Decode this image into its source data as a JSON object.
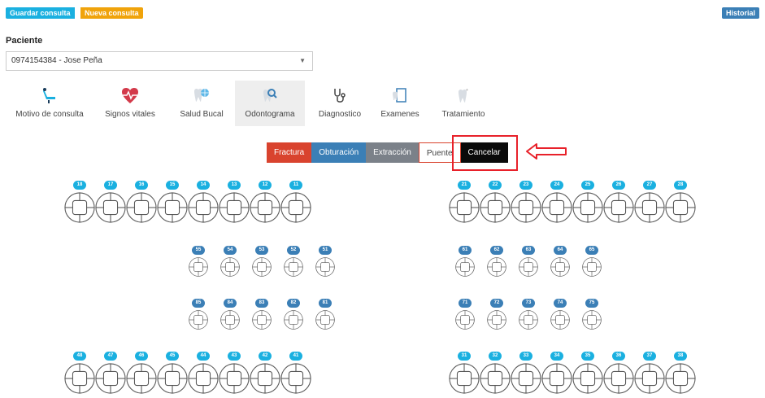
{
  "header": {
    "guardar_label": "Guardar consulta",
    "nueva_label": "Nueva consulta",
    "historial_label": "Historial"
  },
  "paciente": {
    "label": "Paciente",
    "selected": "0974154384 - Jose Peña"
  },
  "tabs": [
    {
      "label": "Motivo de consulta",
      "icon": "dental-chair-icon",
      "active": false
    },
    {
      "label": "Signos vitales",
      "icon": "heartbeat-icon",
      "active": false
    },
    {
      "label": "Salud Bucal",
      "icon": "tooth-globe-icon",
      "active": false
    },
    {
      "label": "Odontograma",
      "icon": "tooth-search-icon",
      "active": true
    },
    {
      "label": "Diagnostico",
      "icon": "stethoscope-icon",
      "active": false
    },
    {
      "label": "Examenes",
      "icon": "clipboard-tooth-icon",
      "active": false
    },
    {
      "label": "Tratamiento",
      "icon": "tooth-icon",
      "active": false
    }
  ],
  "toolbar": {
    "fractura": "Fractura",
    "obturacion": "Obturación",
    "extraccion": "Extracción",
    "puente": "Puente",
    "cancelar": "Cancelar"
  },
  "odontogram": {
    "upper_right_adult": [
      "18",
      "17",
      "16",
      "15",
      "14",
      "13",
      "12",
      "11"
    ],
    "upper_left_adult": [
      "21",
      "22",
      "23",
      "24",
      "25",
      "26",
      "27",
      "28"
    ],
    "upper_right_child": [
      "55",
      "54",
      "53",
      "52",
      "51"
    ],
    "upper_left_child": [
      "61",
      "62",
      "63",
      "64",
      "65"
    ],
    "lower_right_child": [
      "85",
      "84",
      "83",
      "82",
      "81"
    ],
    "lower_left_child": [
      "71",
      "72",
      "73",
      "74",
      "75"
    ],
    "lower_right_adult": [
      "48",
      "47",
      "46",
      "45",
      "44",
      "43",
      "42",
      "41"
    ],
    "lower_left_adult": [
      "31",
      "32",
      "33",
      "34",
      "35",
      "36",
      "37",
      "38"
    ]
  },
  "colors": {
    "adult_badge": "#1ab0e0",
    "child_badge": "#3b7fb6",
    "highlight": "#e8212a"
  }
}
